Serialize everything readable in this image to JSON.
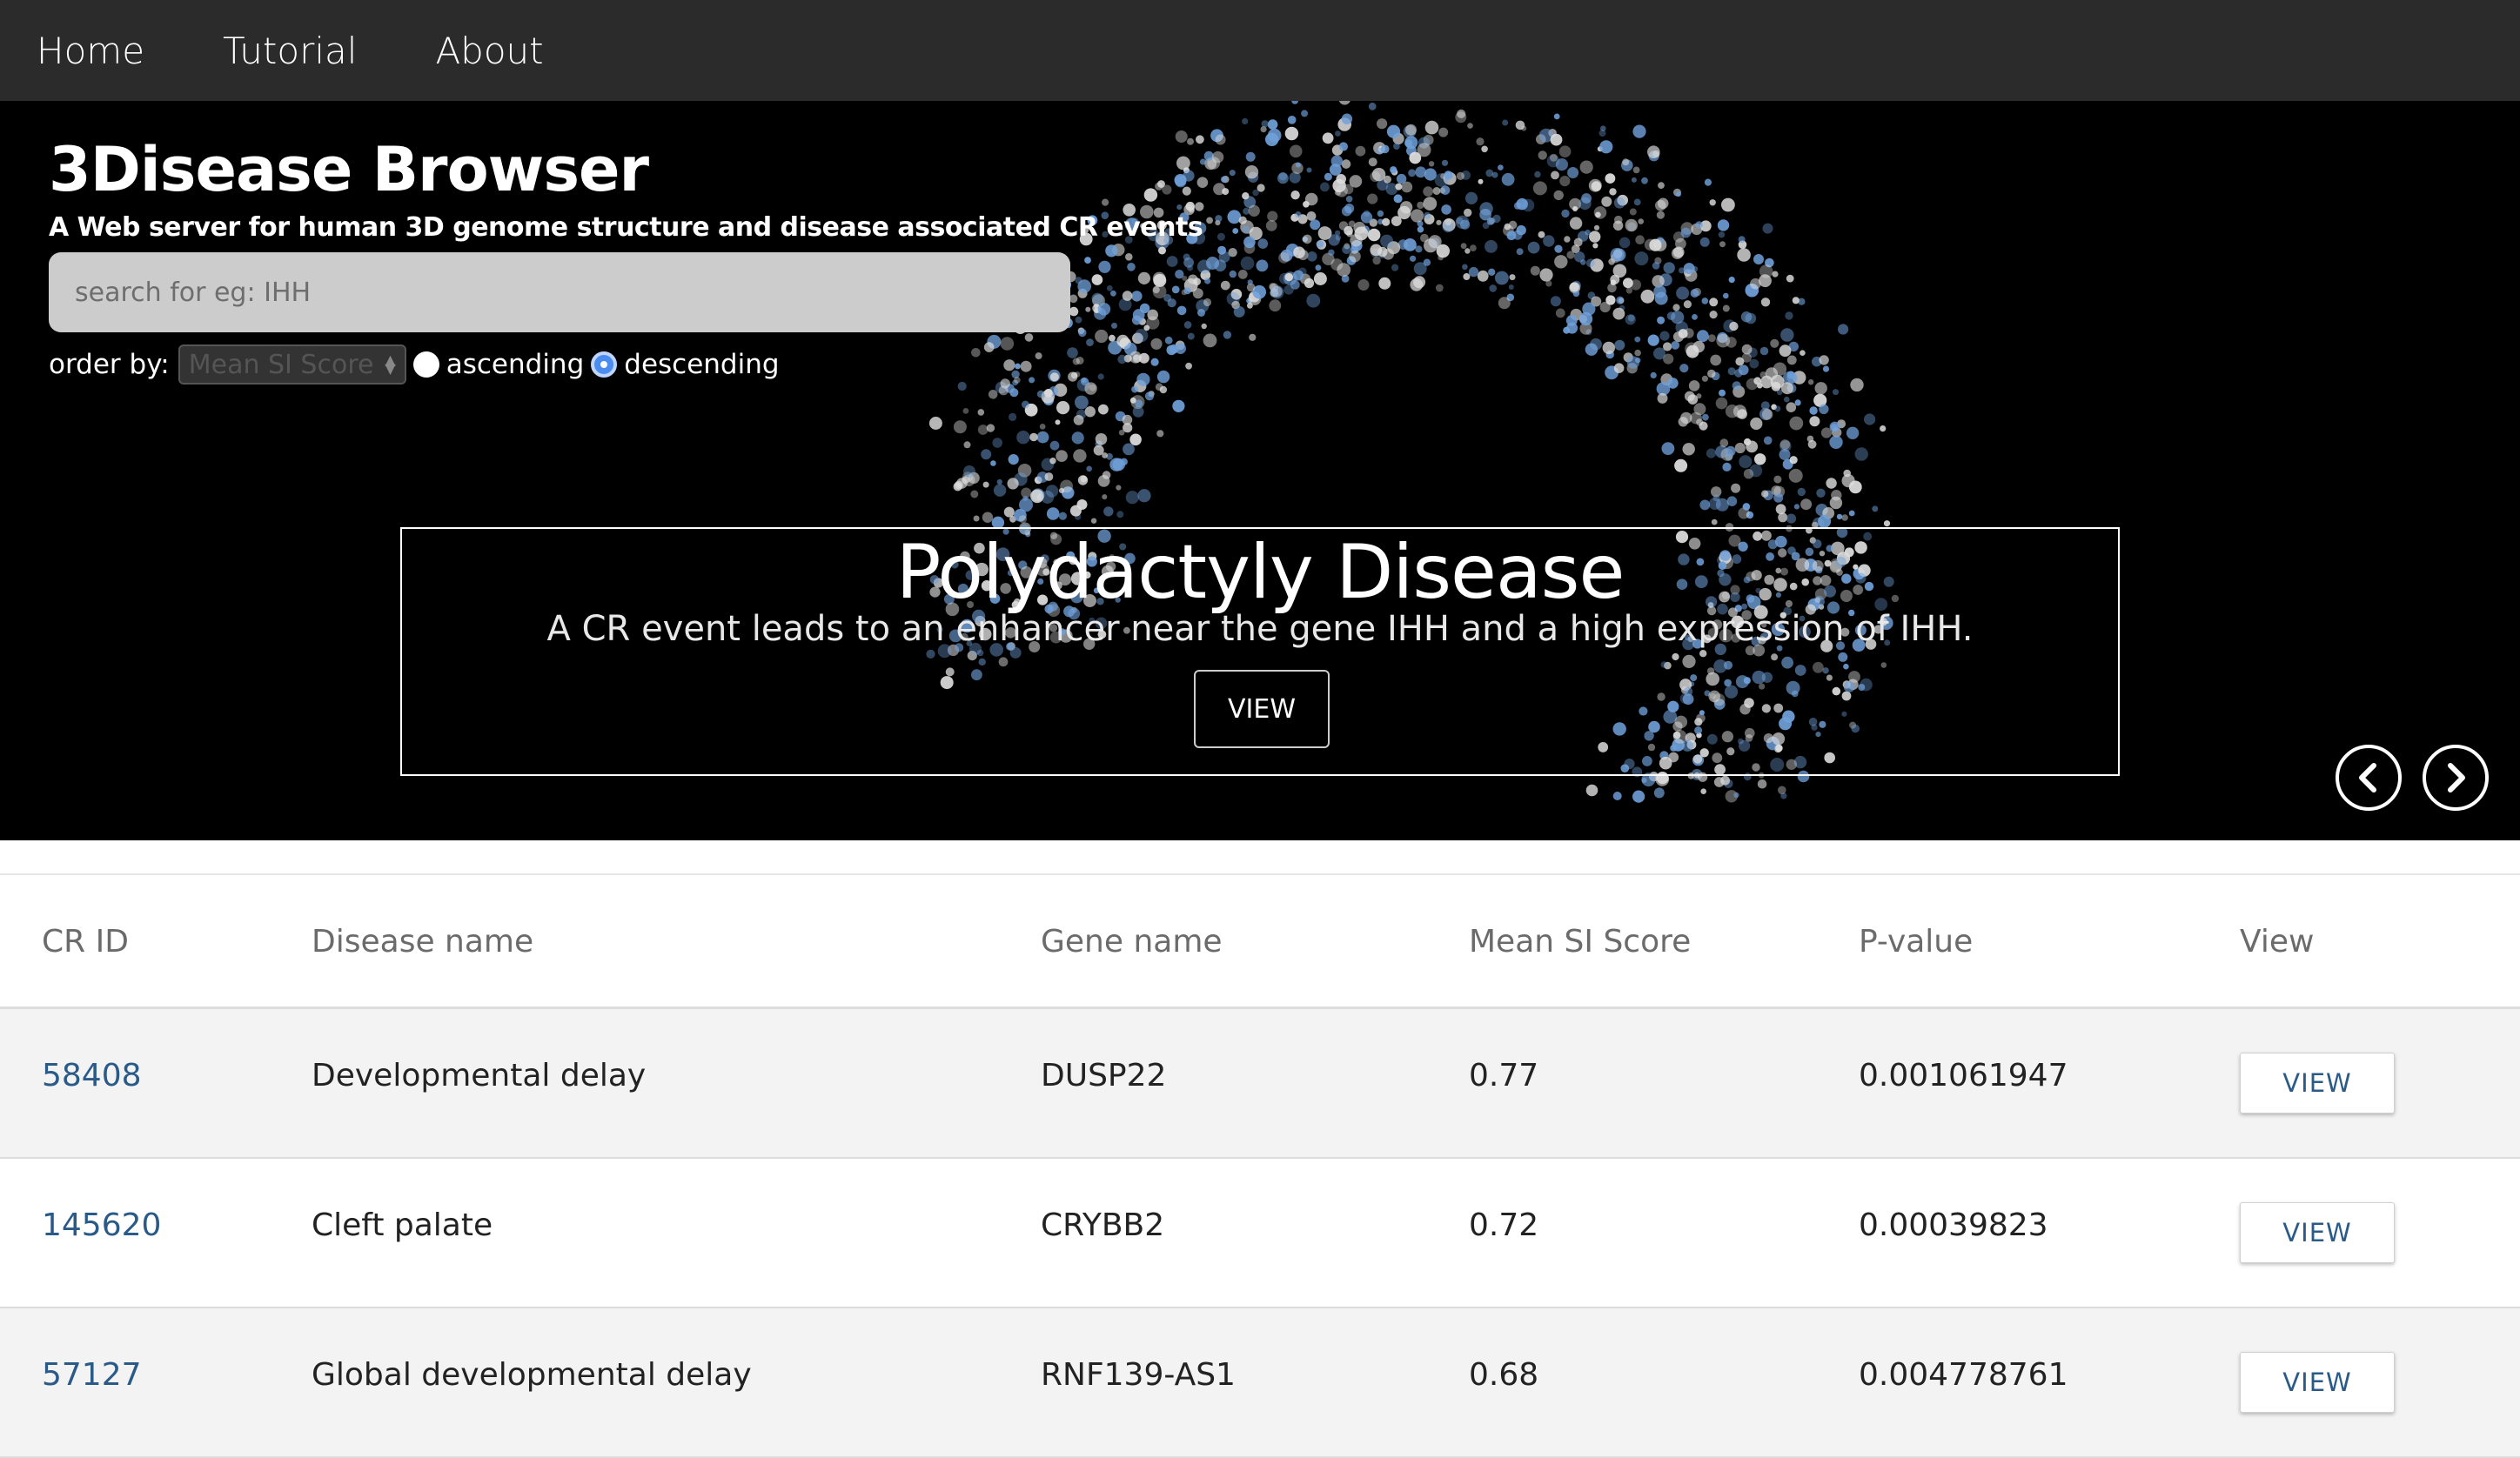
{
  "nav": {
    "items": [
      "Home",
      "Tutorial",
      "About"
    ]
  },
  "brand": {
    "title": "3Disease Browser",
    "subtitle": "A Web server for human 3D genome structure and disease associated CR events"
  },
  "search": {
    "placeholder": "search for eg: IHH",
    "value": ""
  },
  "order": {
    "label": "order by:",
    "selected": "Mean SI Score",
    "asc_label": "ascending",
    "desc_label": "descending",
    "direction": "descending"
  },
  "carousel": {
    "title": "Polydactyly Disease",
    "text": "A CR event leads to an enhancer near the gene IHH and a high expression of IHH.",
    "button": "VIEW",
    "prev_icon": "chevron-left-icon",
    "next_icon": "chevron-right-icon"
  },
  "table": {
    "headers": [
      "CR ID",
      "Disease name",
      "Gene name",
      "Mean SI Score",
      "P-value",
      "View"
    ],
    "rows": [
      {
        "id": "58408",
        "disease": "Developmental delay",
        "gene": "DUSP22",
        "score": "0.77",
        "pvalue": "0.001061947",
        "view": "VIEW"
      },
      {
        "id": "145620",
        "disease": "Cleft palate",
        "gene": "CRYBB2",
        "score": "0.72",
        "pvalue": "0.00039823",
        "view": "VIEW"
      },
      {
        "id": "57127",
        "disease": "Global developmental delay",
        "gene": "RNF139-AS1",
        "score": "0.68",
        "pvalue": "0.004778761",
        "view": "VIEW"
      }
    ]
  },
  "colors": {
    "navbar": "#2b2b2b",
    "hero": "#000000",
    "link": "#2a5a88",
    "row_shade": "#f3f3f3",
    "blue_dots": "#6f9fd8",
    "white_dots": "#dcdcdc"
  }
}
